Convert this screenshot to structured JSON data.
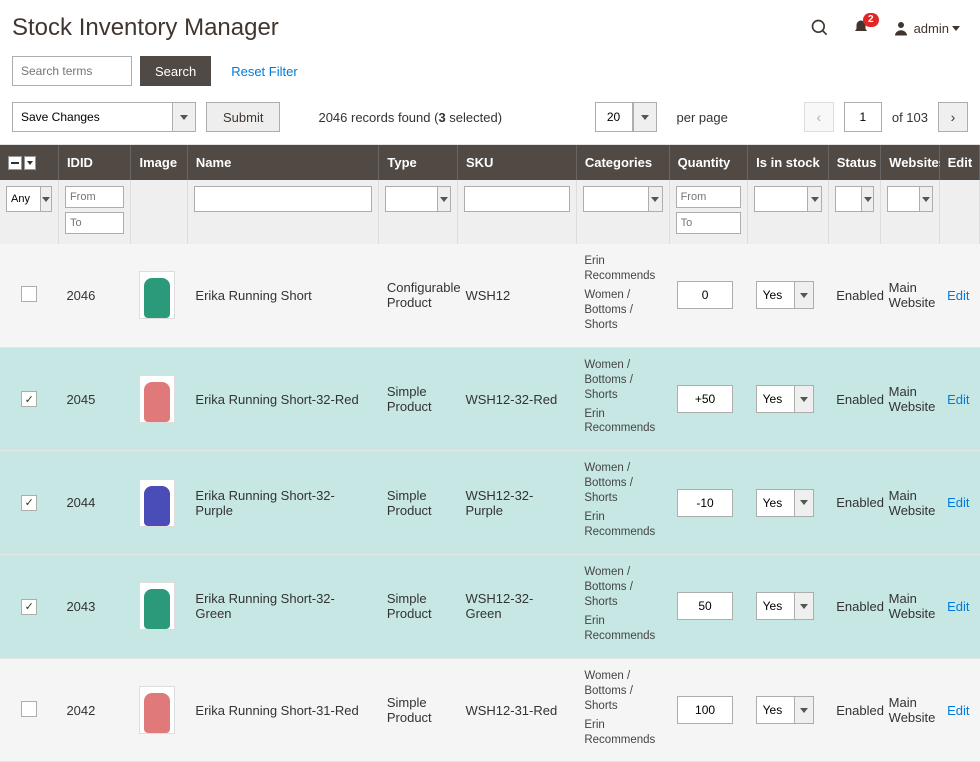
{
  "header": {
    "title": "Stock Inventory Manager",
    "notifications": "2",
    "user": "admin"
  },
  "toolbar": {
    "search_placeholder": "Search terms",
    "search_btn": "Search",
    "reset_filter": "Reset Filter",
    "save_changes": "Save Changes",
    "submit": "Submit",
    "records_found_prefix": "2046 records found (",
    "records_found_bold": "3",
    "records_found_suffix": " selected)",
    "per_page_value": "20",
    "per_page_label": "per page",
    "page_value": "1",
    "of_pages": "of 103"
  },
  "columns": {
    "id": "ID",
    "image": "Image",
    "name": "Name",
    "type": "Type",
    "sku": "SKU",
    "categories": "Categories",
    "quantity": "Quantity",
    "in_stock": "Is in stock",
    "status": "Status",
    "websites": "Websites",
    "edit": "Edit"
  },
  "filters": {
    "any": "Any",
    "from": "From",
    "to": "To"
  },
  "rows": [
    {
      "selected": false,
      "id": "2046",
      "color": "#2b9a7a",
      "name": "Erika Running Short",
      "type": "Configurable Product",
      "sku": "WSH12",
      "cats": [
        "Erin Recommends",
        "Women / Bottoms / Shorts"
      ],
      "qty": "0",
      "stock": "Yes",
      "status": "Enabled",
      "web": "Main Website",
      "edit": "Edit"
    },
    {
      "selected": true,
      "id": "2045",
      "color": "#e07a7a",
      "name": "Erika Running Short-32-Red",
      "type": "Simple Product",
      "sku": "WSH12-32-Red",
      "cats": [
        "Women / Bottoms / Shorts",
        "Erin Recommends"
      ],
      "qty": "+50",
      "stock": "Yes",
      "status": "Enabled",
      "web": "Main Website",
      "edit": "Edit"
    },
    {
      "selected": true,
      "id": "2044",
      "color": "#4a4db8",
      "name": "Erika Running Short-32-Purple",
      "type": "Simple Product",
      "sku": "WSH12-32-Purple",
      "cats": [
        "Women / Bottoms / Shorts",
        "Erin Recommends"
      ],
      "qty": "-10",
      "stock": "Yes",
      "status": "Enabled",
      "web": "Main Website",
      "edit": "Edit"
    },
    {
      "selected": true,
      "id": "2043",
      "color": "#2b9a7a",
      "name": "Erika Running Short-32-Green",
      "type": "Simple Product",
      "sku": "WSH12-32-Green",
      "cats": [
        "Women / Bottoms / Shorts",
        "Erin Recommends"
      ],
      "qty": "50",
      "stock": "Yes",
      "status": "Enabled",
      "web": "Main Website",
      "edit": "Edit"
    },
    {
      "selected": false,
      "id": "2042",
      "color": "#e07a7a",
      "name": "Erika Running Short-31-Red",
      "type": "Simple Product",
      "sku": "WSH12-31-Red",
      "cats": [
        "Women / Bottoms / Shorts",
        "Erin Recommends"
      ],
      "qty": "100",
      "stock": "Yes",
      "status": "Enabled",
      "web": "Main Website",
      "edit": "Edit"
    }
  ]
}
